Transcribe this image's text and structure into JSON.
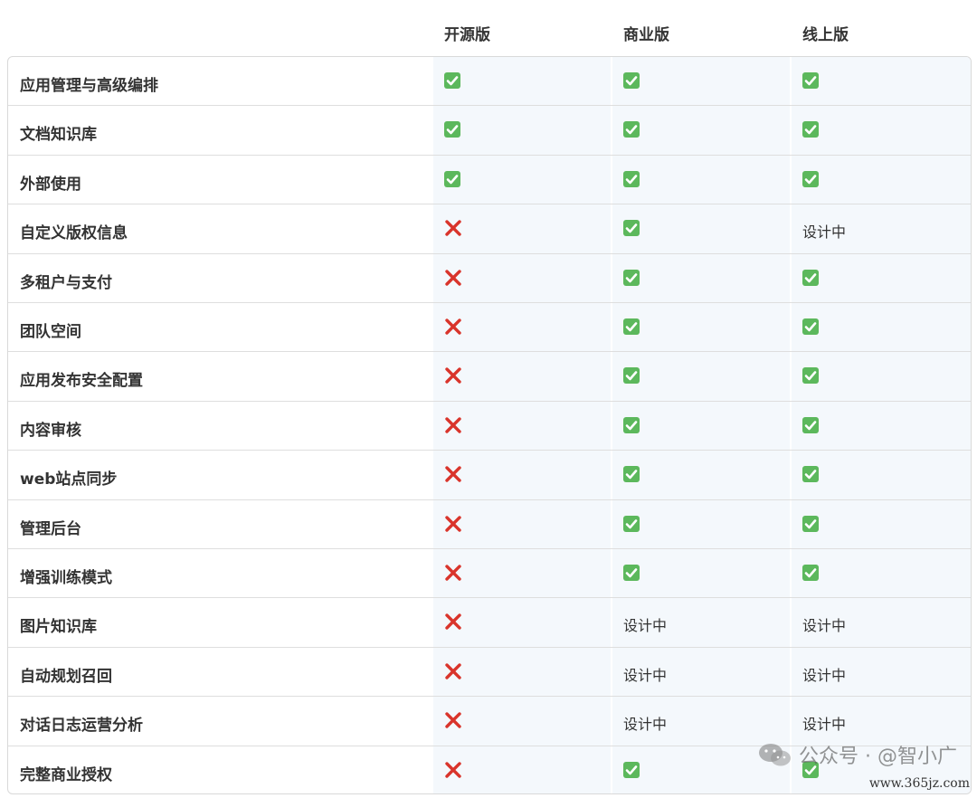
{
  "header": {
    "columns": [
      "开源版",
      "商业版",
      "线上版"
    ]
  },
  "rows": [
    {
      "feature": "应用管理与高级编排",
      "values": [
        "check",
        "check",
        "check"
      ]
    },
    {
      "feature": "文档知识库",
      "values": [
        "check",
        "check",
        "check"
      ]
    },
    {
      "feature": "外部使用",
      "values": [
        "check",
        "check",
        "check"
      ]
    },
    {
      "feature": "自定义版权信息",
      "values": [
        "cross",
        "check",
        "设计中"
      ]
    },
    {
      "feature": "多租户与支付",
      "values": [
        "cross",
        "check",
        "check"
      ]
    },
    {
      "feature": "团队空间",
      "values": [
        "cross",
        "check",
        "check"
      ]
    },
    {
      "feature": "应用发布安全配置",
      "values": [
        "cross",
        "check",
        "check"
      ]
    },
    {
      "feature": "内容审核",
      "values": [
        "cross",
        "check",
        "check"
      ]
    },
    {
      "feature": "web站点同步",
      "values": [
        "cross",
        "check",
        "check"
      ]
    },
    {
      "feature": "管理后台",
      "values": [
        "cross",
        "check",
        "check"
      ]
    },
    {
      "feature": "增强训练模式",
      "values": [
        "cross",
        "check",
        "check"
      ]
    },
    {
      "feature": "图片知识库",
      "values": [
        "cross",
        "设计中",
        "设计中"
      ]
    },
    {
      "feature": "自动规划召回",
      "values": [
        "cross",
        "设计中",
        "设计中"
      ]
    },
    {
      "feature": "对话日志运营分析",
      "values": [
        "cross",
        "设计中",
        "设计中"
      ]
    },
    {
      "feature": "完整商业授权",
      "values": [
        "cross",
        "check",
        "check"
      ]
    }
  ],
  "icons": {
    "check": "check-box-icon",
    "cross": "cross-mark-icon"
  },
  "colors": {
    "check": "#5cb85c",
    "cross": "#d9342b",
    "column_tint": "#f4f8fc"
  },
  "watermark": {
    "text": "公众号 · @智小广",
    "icon": "wechat-icon"
  },
  "site": "www.365jz.com"
}
